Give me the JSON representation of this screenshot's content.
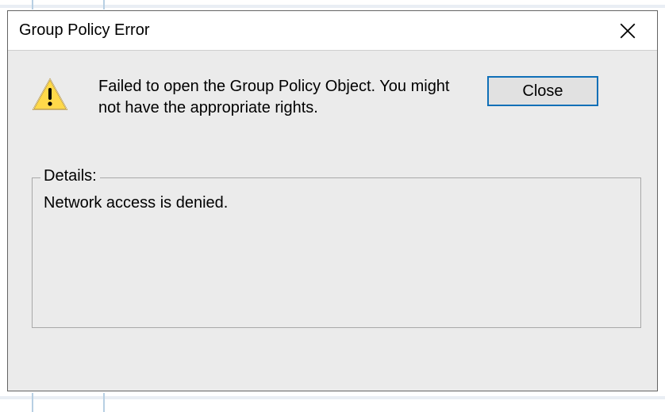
{
  "dialog": {
    "title": "Group Policy Error",
    "message": "Failed to open the Group Policy Object.  You might not have the appropriate rights.",
    "close_button_label": "Close",
    "details_label": "Details:",
    "details_text": "Network access is denied."
  }
}
